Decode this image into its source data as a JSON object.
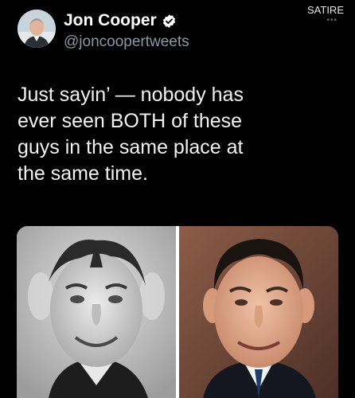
{
  "tweet": {
    "author_name": "Jon Cooper",
    "handle": "@joncoopertweets",
    "badge": "SATIRE",
    "more_label": "•••",
    "verified_icon": "verified-badge-icon",
    "text": "Just sayin’ — nobody has\never seen BOTH of these\nguys in the same place at\nthe same time."
  },
  "colors": {
    "background": "#000000",
    "handle": "#8b98a5",
    "verified": "#ffffff"
  }
}
